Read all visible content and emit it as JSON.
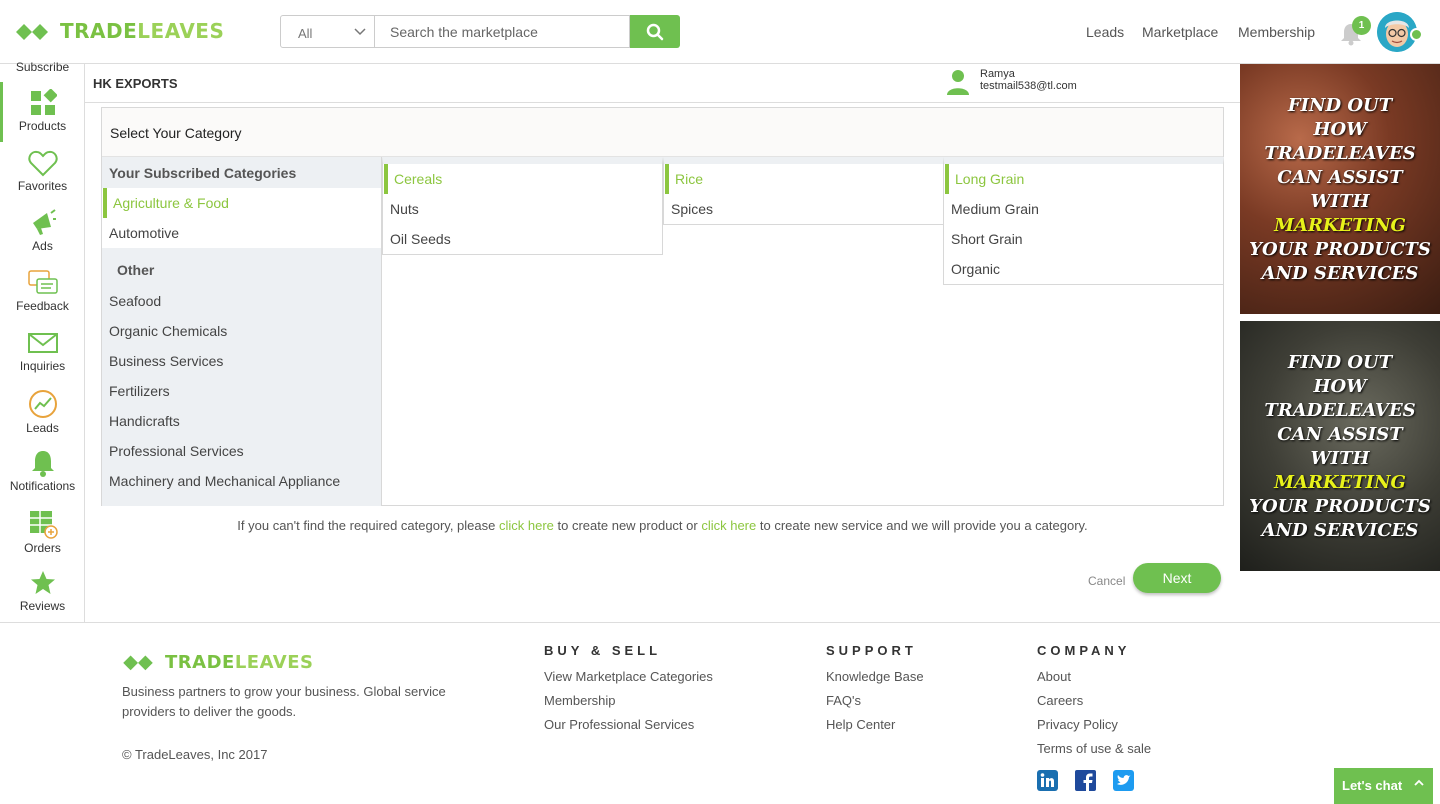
{
  "header": {
    "logo_text_1": "TRADE",
    "logo_text_2": "LEAVES",
    "search_category": "All",
    "search_placeholder": "Search the marketplace",
    "nav": [
      "Leads",
      "Marketplace",
      "Membership"
    ],
    "notification_count": "1"
  },
  "sidebar": {
    "partial_label": "Subscribe",
    "items": [
      "Products",
      "Favorites",
      "Ads",
      "Feedback",
      "Inquiries",
      "Leads",
      "Notifications",
      "Orders",
      "Reviews"
    ]
  },
  "page": {
    "company": "HK EXPORTS",
    "user_name": "Ramya",
    "user_email": "testmail538@tl.com"
  },
  "category": {
    "title": "Select Your Category",
    "subscribed_heading": "Your Subscribed Categories",
    "subscribed": [
      "Agriculture & Food",
      "Automotive"
    ],
    "other_heading": "Other",
    "other": [
      "Seafood",
      "Organic Chemicals",
      "Business Services",
      "Fertilizers",
      "Handicrafts",
      "Professional Services",
      "Machinery and Mechanical Appliance"
    ],
    "level2": [
      "Cereals",
      "Nuts",
      "Oil Seeds"
    ],
    "level3": [
      "Rice",
      "Spices"
    ],
    "level4": [
      "Long Grain",
      "Medium Grain",
      "Short Grain",
      "Organic"
    ]
  },
  "help": {
    "t1": "If you can't find the required category, please ",
    "link1": "click here",
    "t2": " to create new product or ",
    "link2": "click here",
    "t3": " to create new service and we will provide you a category."
  },
  "actions": {
    "cancel": "Cancel",
    "next": "Next"
  },
  "ads": {
    "line1": "FIND OUT",
    "line2": "HOW",
    "line3": "TRADELEAVES",
    "line4": "CAN ASSIST",
    "line5": "WITH",
    "highlight": "MARKETING",
    "line6": "YOUR PRODUCTS",
    "line7": "AND SERVICES"
  },
  "footer": {
    "desc": "Business partners to grow your business. Global service providers to deliver the goods.",
    "copyright": "© TradeLeaves, Inc 2017",
    "buy_sell": {
      "title": "BUY & SELL",
      "links": [
        "View Marketplace Categories",
        "Membership",
        "Our Professional Services"
      ]
    },
    "support": {
      "title": "SUPPORT",
      "links": [
        "Knowledge Base",
        "FAQ's",
        "Help Center"
      ]
    },
    "company": {
      "title": "COMPANY",
      "links": [
        "About",
        "Careers",
        "Privacy Policy",
        "Terms of use & sale"
      ]
    }
  },
  "chat": {
    "label": "Let's chat"
  },
  "colors": {
    "brand_green": "#6fc050",
    "accent_green": "#8cc63f",
    "highlight_yellow": "#e8f21a"
  }
}
